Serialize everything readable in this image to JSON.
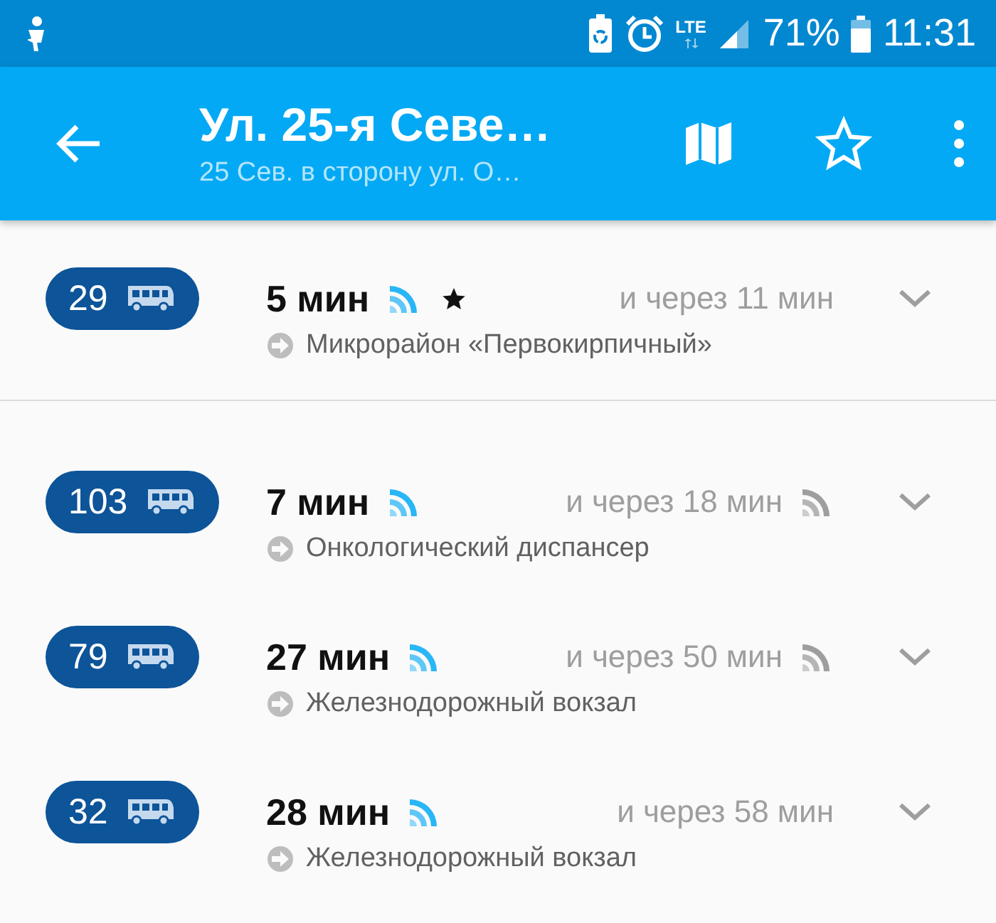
{
  "status_bar": {
    "network": "LTE",
    "battery": "71%",
    "time": "11:31"
  },
  "toolbar": {
    "title": "Ул. 25-я Севе…",
    "subtitle": "25 Сев. в сторону ул. О…"
  },
  "groups": [
    {
      "routes": [
        {
          "number": "29",
          "first": "5 мин",
          "first_live": true,
          "favorite": true,
          "next": "и через 11 мин",
          "next_live": false,
          "destination": "Микрорайон «Первокирпичный»"
        }
      ]
    },
    {
      "routes": [
        {
          "number": "103",
          "first": "7 мин",
          "first_live": true,
          "favorite": false,
          "next": "и через 18 мин",
          "next_live": true,
          "destination": "Онкологический диспансер"
        },
        {
          "number": "79",
          "first": "27 мин",
          "first_live": true,
          "favorite": false,
          "next": "и через 50 мин",
          "next_live": true,
          "destination": "Железнодорожный вокзал"
        },
        {
          "number": "32",
          "first": "28 мин",
          "first_live": true,
          "favorite": false,
          "next": "и через 58 мин",
          "next_live": false,
          "destination": "Железнодорожный вокзал"
        }
      ]
    }
  ]
}
